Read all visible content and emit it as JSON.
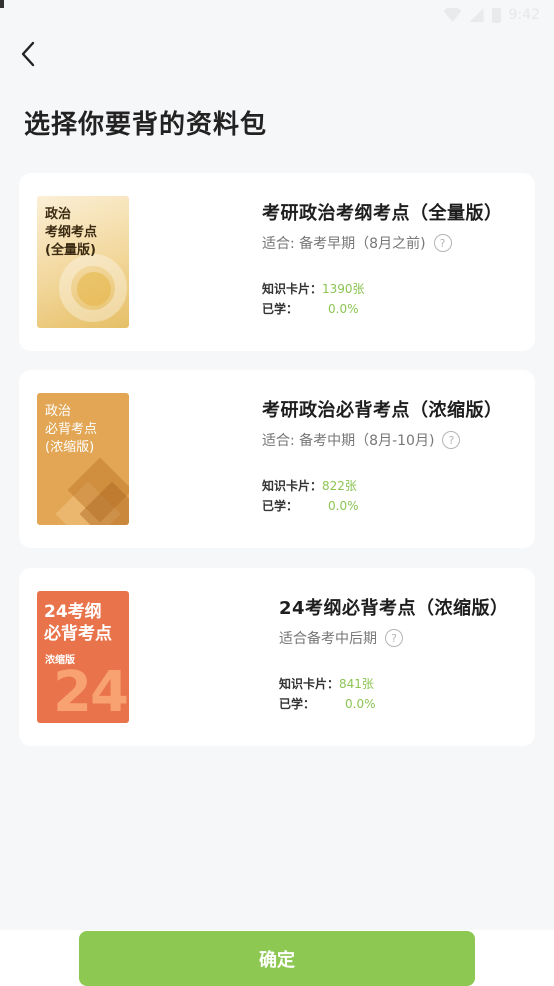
{
  "status_bar": {
    "time": "9:42",
    "icons": [
      "wifi-icon",
      "signal-icon",
      "battery-icon"
    ]
  },
  "header": {
    "back_icon": "chevron-left-icon",
    "title": "选择你要背的资料包"
  },
  "accent_color": "#8dc853",
  "packages": [
    {
      "cover_text": "政治\n考纲考点\n(全量版)",
      "title": "考研政治考纲考点（全量版）",
      "suitable": "适合: 备考早期（8月之前)",
      "help_icon": "question-circle-icon",
      "cards_label": "知识卡片：",
      "cards_value": "1390张",
      "learned_label": "已学：",
      "learned_value": "0.0%"
    },
    {
      "cover_text": "政治\n必背考点\n(浓缩版)",
      "title": "考研政治必背考点（浓缩版）",
      "suitable": "适合: 备考中期（8月-10月)",
      "help_icon": "question-circle-icon",
      "cards_label": "知识卡片：",
      "cards_value": "822张",
      "learned_label": "已学：",
      "learned_value": "0.0%"
    },
    {
      "cover_title": "24考纲\n必背考点",
      "cover_tag": "浓缩版",
      "cover_number": "24",
      "title": "24考纲必背考点（浓缩版）",
      "suitable": "适合备考中后期",
      "help_icon": "question-circle-icon",
      "cards_label": "知识卡片：",
      "cards_value": "841张",
      "learned_label": "已学：",
      "learned_value": "0.0%"
    }
  ],
  "confirm_label": "确定"
}
